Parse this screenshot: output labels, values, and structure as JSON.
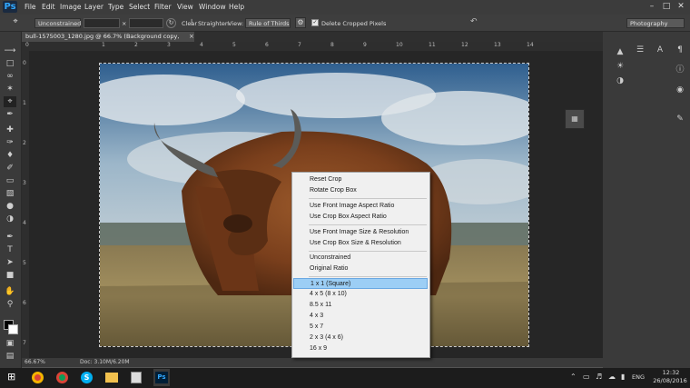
{
  "menu": {
    "logo": "Ps",
    "items": [
      "File",
      "Edit",
      "Image",
      "Layer",
      "Type",
      "Select",
      "Filter",
      "View",
      "Window",
      "Help"
    ]
  },
  "options": {
    "ratio_value": "Unconstrained",
    "swap_label": "×",
    "clear_label": "Clear",
    "straighten_label": "Straighten",
    "view_label": "View:",
    "view_value": "Rule of Thirds",
    "delete_cropped_label": "Delete Cropped Pixels",
    "workspace_value": "Photography"
  },
  "document": {
    "tab_title": "bull-1575003_1280.jpg @ 66.7% (Background copy, RGB/8#) *",
    "zoom": "66.67%",
    "doc_size": "Doc: 3.10M/6.20M"
  },
  "ruler": {
    "top": [
      "0",
      "1",
      "2",
      "3",
      "4",
      "5",
      "6",
      "7",
      "8",
      "9",
      "10",
      "11",
      "12",
      "13",
      "14"
    ],
    "left": [
      "0",
      "1",
      "2",
      "3",
      "4",
      "5",
      "6",
      "7"
    ]
  },
  "context_menu": {
    "groups": [
      [
        "Reset Crop",
        "Rotate Crop Box"
      ],
      [
        "Use Front Image Aspect Ratio",
        "Use Crop Box Aspect Ratio"
      ],
      [
        "Use Front Image Size & Resolution",
        "Use Crop Box Size & Resolution"
      ],
      [
        "Unconstrained",
        "Original Ratio"
      ],
      [
        "1 x 1 (Square)",
        "4 x 5 (8 x 10)",
        "8.5 x 11",
        "4 x 3",
        "5 x 7",
        "2 x 3 (4 x 6)",
        "16 x 9"
      ]
    ],
    "highlighted": "1 x 1 (Square)"
  },
  "taskbar": {
    "time": "12:32",
    "date": "26/08/2016",
    "lang": "ENG"
  },
  "colors": {
    "accent": "#31a8ff",
    "highlight": "#9ccef5"
  }
}
